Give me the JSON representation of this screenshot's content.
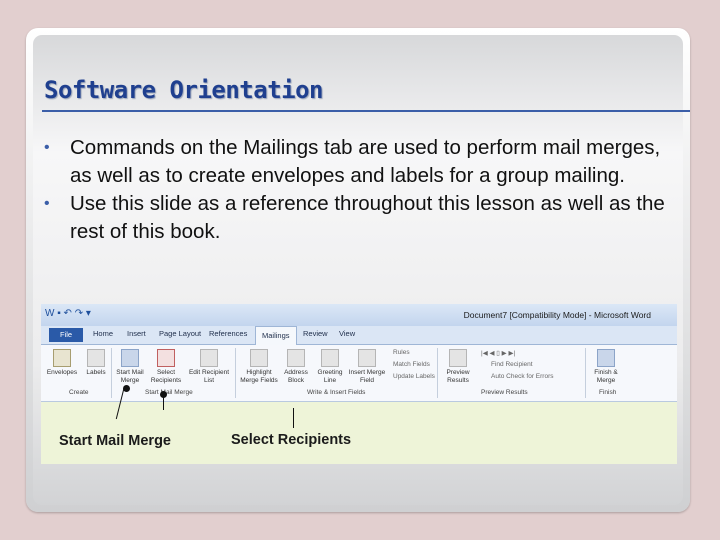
{
  "slide": {
    "title": "Software Orientation",
    "bullets": [
      "Commands on the Mailings tab are used to perform mail merges, as well as to create envelopes and labels for a group mailing.",
      "Use this slide as a reference throughout this lesson as well as the rest of this book."
    ]
  },
  "screenshot": {
    "window_title": "Document7 [Compatibility Mode] - Microsoft Word",
    "tabs": [
      "File",
      "Home",
      "Insert",
      "Page Layout",
      "References",
      "Mailings",
      "Review",
      "View"
    ],
    "active_tab": "Mailings",
    "buttons": {
      "envelopes": "Envelopes",
      "labels": "Labels",
      "start_mail_merge": "Start Mail Merge",
      "select_recipients": "Select Recipients",
      "edit_recipient_list": "Edit Recipient List",
      "highlight_merge_fields": "Highlight Merge Fields",
      "address_block": "Address Block",
      "greeting_line": "Greeting Line",
      "insert_merge_field": "Insert Merge Field",
      "rules": "Rules",
      "match_fields": "Match Fields",
      "update_labels": "Update Labels",
      "preview_results": "Preview Results",
      "find_recipient": "Find Recipient",
      "auto_check_for_errors": "Auto Check for Errors",
      "finish_merge": "Finish & Merge"
    },
    "groups": [
      "Create",
      "Start Mail Merge",
      "Write & Insert Fields",
      "Preview Results",
      "Finish"
    ],
    "callouts": [
      "Start Mail Merge",
      "Select Recipients"
    ]
  }
}
